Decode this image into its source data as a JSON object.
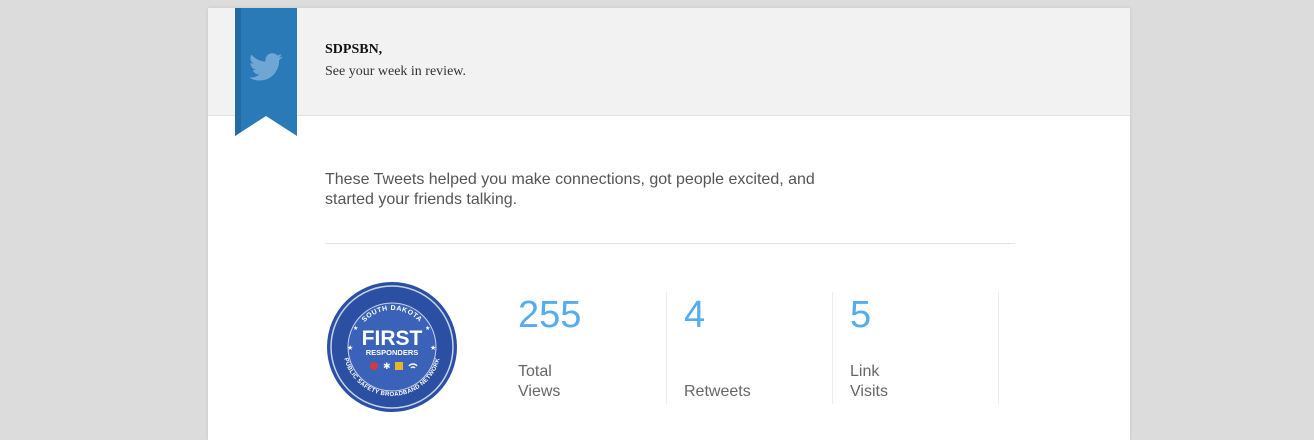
{
  "header": {
    "greeting_name": "SDPSBN,",
    "greeting_sub": "See your week in review."
  },
  "intro": "These Tweets helped you make connections, got people excited, and started your friends talking.",
  "logo": {
    "top_text": "SOUTH DAKOTA",
    "main_text": "FIRST",
    "sub_text": "RESPONDERS",
    "bottom_text": "PUBLIC SAFETY BROADBAND NETWORK"
  },
  "stats": [
    {
      "value": "255",
      "label": "Total Views"
    },
    {
      "value": "4",
      "label": "Retweets"
    },
    {
      "value": "5",
      "label": "Link Visits"
    }
  ],
  "colors": {
    "accent": "#55acee",
    "ribbon": "#2a7ab8",
    "logo_blue": "#2b4fa3"
  },
  "icons": {
    "ribbon": "twitter-bird-icon"
  }
}
